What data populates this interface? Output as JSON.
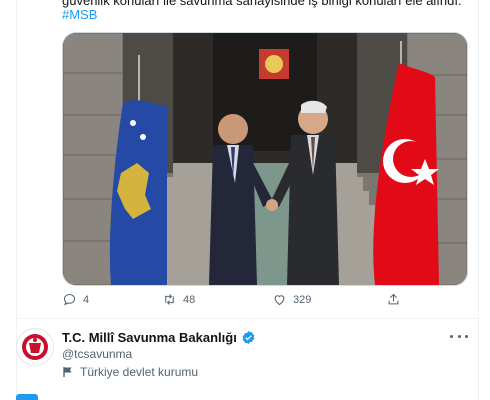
{
  "tweet": {
    "cut_text": "güvenlik konuları ile savunma sanayisinde iş birliği konuları ele alındı.",
    "hashtag": "#MSB"
  },
  "actions": {
    "reply_count": "4",
    "retweet_count": "48",
    "like_count": "329"
  },
  "profile": {
    "name": "T.C. Millî Savunma Bakanlığı",
    "handle": "@tcsavunma",
    "label": "Türkiye devlet kurumu"
  },
  "colors": {
    "accent": "#1d9bf0",
    "text": "#0f1419",
    "muted": "#536471",
    "kosovo_flag": "#244aa5",
    "turkey_flag": "#e30a17"
  },
  "icons": {
    "reply": "reply-icon",
    "retweet": "retweet-icon",
    "like": "heart-icon",
    "share": "share-icon",
    "verified": "verified-badge-icon",
    "label": "flag-icon",
    "more": "more-icon"
  }
}
